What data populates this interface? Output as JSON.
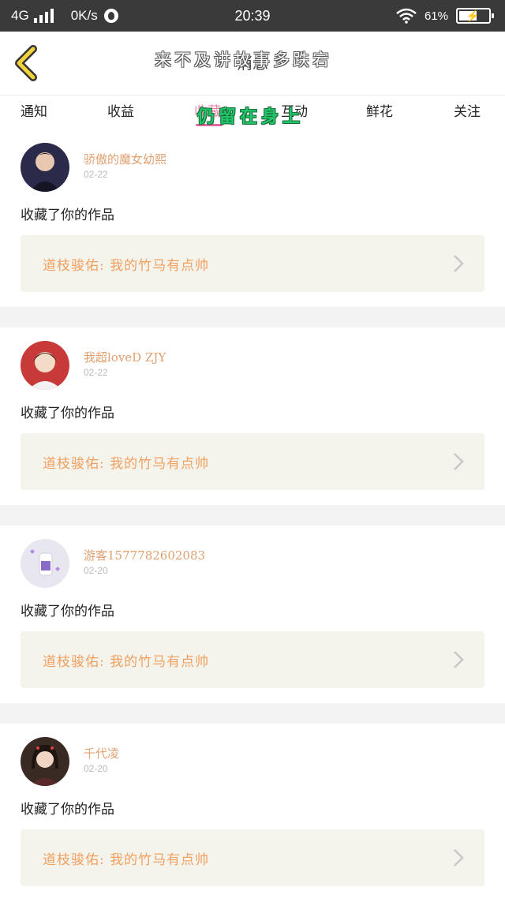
{
  "status_bar": {
    "network": "4G",
    "speed": "0K/s",
    "time": "20:39",
    "battery": "61%"
  },
  "header": {
    "title": "消息",
    "back_icon": "chevron-left-icon",
    "accent_color": "#f2d23a"
  },
  "overlay_text": {
    "line1": "来不及讲故事多跌宕",
    "line2": "仍留在身上"
  },
  "tabs": [
    {
      "label": "通知",
      "active": false
    },
    {
      "label": "收益",
      "active": false
    },
    {
      "label": "收藏",
      "active": true
    },
    {
      "label": "互动",
      "active": false
    },
    {
      "label": "鲜花",
      "active": false
    },
    {
      "label": "关注",
      "active": false
    }
  ],
  "feed": [
    {
      "username": "骄傲的魔女幼熙",
      "date": "02-22",
      "action": "收藏了你的作品",
      "work_title": "道枝骏佑: 我的竹马有点帅",
      "avatar": "avatar-1"
    },
    {
      "username": "我超loveD ZJY",
      "date": "02-22",
      "action": "收藏了你的作品",
      "work_title": "道枝骏佑: 我的竹马有点帅",
      "avatar": "avatar-2"
    },
    {
      "username": "游客1577782602083",
      "date": "02-20",
      "action": "收藏了你的作品",
      "work_title": "道枝骏佑: 我的竹马有点帅",
      "avatar": "avatar-3"
    },
    {
      "username": "千代凌",
      "date": "02-20",
      "action": "收藏了你的作品",
      "work_title": "道枝骏佑: 我的竹马有点帅",
      "avatar": "avatar-4"
    }
  ]
}
